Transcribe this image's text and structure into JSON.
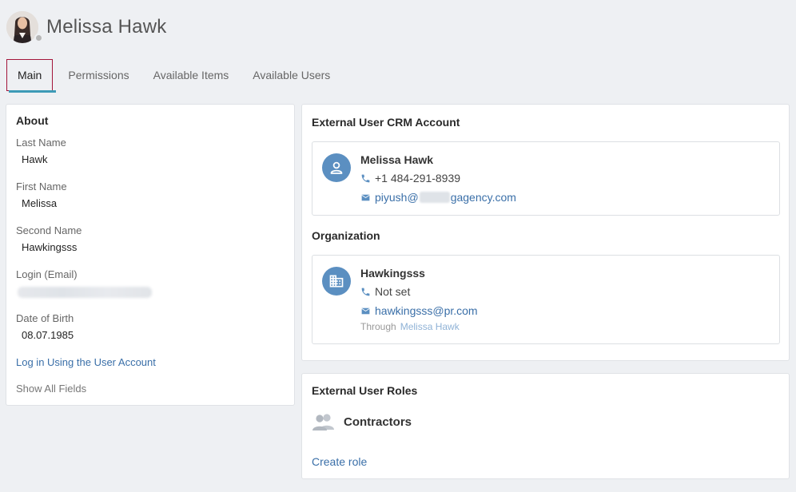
{
  "header": {
    "user_name": "Melissa Hawk"
  },
  "tabs": [
    {
      "label": "Main",
      "active": true
    },
    {
      "label": "Permissions",
      "active": false
    },
    {
      "label": "Available Items",
      "active": false
    },
    {
      "label": "Available Users",
      "active": false
    }
  ],
  "about": {
    "title": "About",
    "fields": [
      {
        "label": "Last Name",
        "value": "Hawk"
      },
      {
        "label": "First Name",
        "value": "Melissa"
      },
      {
        "label": "Second Name",
        "value": "Hawkingsss"
      },
      {
        "label": "Login (Email)",
        "value": ""
      },
      {
        "label": "Date of Birth",
        "value": "08.07.1985"
      }
    ],
    "login_link": "Log in Using the User Account",
    "show_all": "Show All Fields"
  },
  "crm": {
    "title": "External User CRM Account",
    "name": "Melissa Hawk",
    "phone": "+1 484-291-8939",
    "email_prefix": "piyush@",
    "email_suffix": "gagency.com"
  },
  "organization": {
    "title": "Organization",
    "name": "Hawkingsss",
    "phone": "Not set",
    "email": "hawkingsss@pr.com",
    "through_label": "Through",
    "through_link": "Melissa Hawk"
  },
  "roles": {
    "title": "External User Roles",
    "role": "Contractors",
    "create_link": "Create role"
  },
  "colors": {
    "accent": "#3a6fa8",
    "active_tab_border": "#a3153a",
    "tab_underline": "#3e9bb7",
    "entity_icon_bg": "#5b8fc1"
  },
  "icons": [
    "person-icon",
    "building-icon",
    "phone-icon",
    "mail-icon",
    "group-icon"
  ]
}
